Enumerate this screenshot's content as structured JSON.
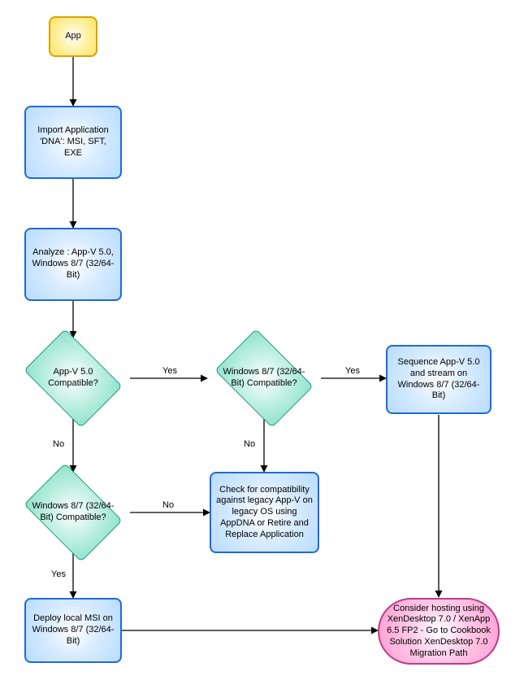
{
  "nodes": {
    "start": "App",
    "import": "Import Application 'DNA': MSI, SFT, EXE",
    "analyze": "Analyze : App-V 5.0, Windows 8/7 (32/64-Bit)",
    "appv": "App-V 5.0 Compatible?",
    "win1": "Windows 8/7 (32/64-Bit) Compatible?",
    "sequence": "Sequence App-V 5.0 and stream on Windows 8/7 (32/64-Bit)",
    "check": "Check for compatibility against legacy App-V on legacy OS using AppDNA or Retire and Replace Application",
    "win2": "Windows 8/7 (32/64-Bit) Compatible?",
    "deploy": "Deploy local MSI on Windows 8/7 (32/64-Bit)",
    "consider": "Consider hosting using XenDesktop 7.0 / XenApp 6.5 FP2 - Go to Cookbook Solution XenDesktop 7.0 Migration Path"
  },
  "labels": {
    "yes": "Yes",
    "no": "No"
  }
}
